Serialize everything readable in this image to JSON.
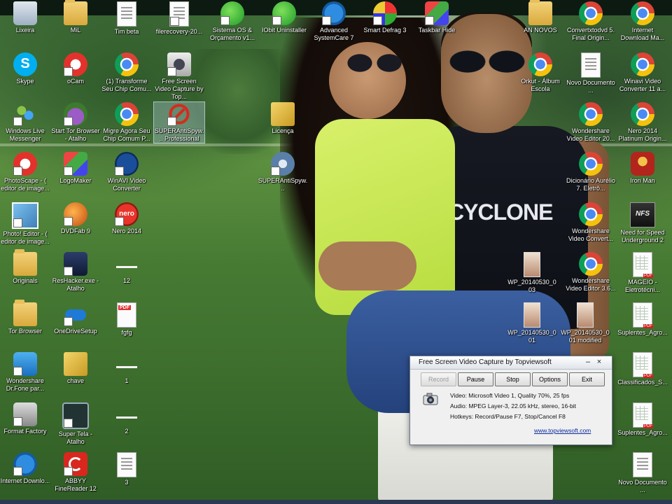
{
  "desktop_icons": [
    {
      "label": "Lixeira",
      "icon": "recycle-bin-icon"
    },
    {
      "label": "MiL",
      "icon": "folder-icon"
    },
    {
      "label": "Tim beta",
      "icon": "document-icon"
    },
    {
      "label": "filerecovery-20...",
      "icon": "document-icon"
    },
    {
      "label": "Sistema OS & Orçamento v1...",
      "icon": "app-icon"
    },
    {
      "label": "IObit Uninstaller",
      "icon": "iobit-uninstaller-icon"
    },
    {
      "label": "Advanced SystemCare 7",
      "icon": "advanced-systemcare-icon"
    },
    {
      "label": "Smart Defrag 3",
      "icon": "smart-defrag-icon"
    },
    {
      "label": "Taskbar Hide",
      "icon": "taskbar-hide-icon"
    },
    {
      "label": "AN NOVOS",
      "icon": "folder-icon"
    },
    {
      "label": "Convertxtodvd 5. Final Origin...",
      "icon": "chrome-icon"
    },
    {
      "label": "Internet Download Ma...",
      "icon": "chrome-icon"
    },
    {
      "label": "Skype",
      "icon": "skype-icon"
    },
    {
      "label": "oCam",
      "icon": "ocam-icon"
    },
    {
      "label": "(1) Transforme Seu Chip Comu...",
      "icon": "chrome-icon"
    },
    {
      "label": "Free Screen Video Capture by Top...",
      "icon": "camera-icon"
    },
    {
      "label": "Orkut - Álbum Escola",
      "icon": "chrome-icon"
    },
    {
      "label": "Novo Documento ...",
      "icon": "document-icon"
    },
    {
      "label": "Winavi Video Converter 11 a...",
      "icon": "chrome-icon"
    },
    {
      "label": "Windows Live Messenger",
      "icon": "messenger-icon"
    },
    {
      "label": "Start Tor Browser - Atalho",
      "icon": "tor-icon"
    },
    {
      "label": "Migre Agora Seu Chip Comum P...",
      "icon": "chrome-icon"
    },
    {
      "label": "SUPERAntiSpyw... Professional",
      "icon": "superantispyware-icon"
    },
    {
      "label": "Licença",
      "icon": "key-icon"
    },
    {
      "label": "Wondershare Video Editor 20...",
      "icon": "chrome-icon"
    },
    {
      "label": "Nero 2014 Platinum Origin...",
      "icon": "chrome-icon"
    },
    {
      "label": "PhotoScape - ( editor de image...",
      "icon": "photoscape-icon"
    },
    {
      "label": "LogoMaker",
      "icon": "logomaker-icon"
    },
    {
      "label": "WinAVI Video Converter",
      "icon": "winavi-icon"
    },
    {
      "label": "SUPERAntiSpyw...",
      "icon": "superantispyware-icon"
    },
    {
      "label": "Dicionário Aurélio 7. Eletrô...",
      "icon": "chrome-icon"
    },
    {
      "label": "Iron Man",
      "icon": "ironman-icon"
    },
    {
      "label": "Photo! Editor - ( editor de image...",
      "icon": "photo-editor-icon"
    },
    {
      "label": "DVDFab 9",
      "icon": "dvdfab-icon"
    },
    {
      "label": "Nero 2014",
      "icon": "nero-icon"
    },
    {
      "label": "Wondershare Video Convert...",
      "icon": "chrome-icon"
    },
    {
      "label": "Need for Speed Underground 2",
      "icon": "nfs-icon"
    },
    {
      "label": "Originals",
      "icon": "folder-icon"
    },
    {
      "label": "ResHacker.exe - Atalho",
      "icon": "reshacker-icon"
    },
    {
      "label": "12",
      "icon": "image-file-icon"
    },
    {
      "label": "WP_20140530_003",
      "icon": "photo-thumbnail-icon"
    },
    {
      "label": "Wondershare Video Editor 3.6...",
      "icon": "chrome-icon"
    },
    {
      "label": "MAGEIO - Eletrotécni...",
      "icon": "pdf-document-icon"
    },
    {
      "label": "Tor Browser",
      "icon": "folder-icon"
    },
    {
      "label": "OneDriveSetup",
      "icon": "onedrive-icon"
    },
    {
      "label": "fgfg",
      "icon": "pdf-icon"
    },
    {
      "label": "WP_20140530_001",
      "icon": "photo-thumbnail-icon"
    },
    {
      "label": "WP_20140530_001 modified",
      "icon": "photo-thumbnail-icon"
    },
    {
      "label": "Suplentes_Agro...",
      "icon": "pdf-document-icon"
    },
    {
      "label": "Wondershare Dr.Fone par...",
      "icon": "drfone-icon"
    },
    {
      "label": "chave",
      "icon": "key-icon"
    },
    {
      "label": "1",
      "icon": "image-file-icon"
    },
    {
      "label": "Classificados_S...",
      "icon": "pdf-document-icon"
    },
    {
      "label": "Format Factory",
      "icon": "format-factory-icon"
    },
    {
      "label": "Super Tela - Atalho",
      "icon": "tv-icon"
    },
    {
      "label": "2",
      "icon": "image-file-icon"
    },
    {
      "label": "Suplentes_Agro...",
      "icon": "pdf-document-icon"
    },
    {
      "label": "Internet Downlo...",
      "icon": "idm-icon"
    },
    {
      "label": "ABBYY FineReader 12",
      "icon": "abbyy-icon"
    },
    {
      "label": "3",
      "icon": "document-icon"
    },
    {
      "label": "Novo Documento ...",
      "icon": "document-icon"
    }
  ],
  "wallpaper": {
    "shirt_text": "CYCLONE"
  },
  "capture_window": {
    "title": "Free Screen Video Capture by Topviewsoft",
    "minimize": "–",
    "close": "×",
    "buttons": [
      "Record",
      "Pause",
      "Stop",
      "Options",
      "Exit"
    ],
    "video_info": "Video: Microsoft Video 1, Quality 70%, 25 fps",
    "audio_info": "Audio: MPEG Layer-3, 22.05 kHz, stereo, 16-bit",
    "hotkeys_info": "Hotkeys: Record/Pause F7, Stop/Cancel F8",
    "link": "www.topviewsoft.com"
  }
}
